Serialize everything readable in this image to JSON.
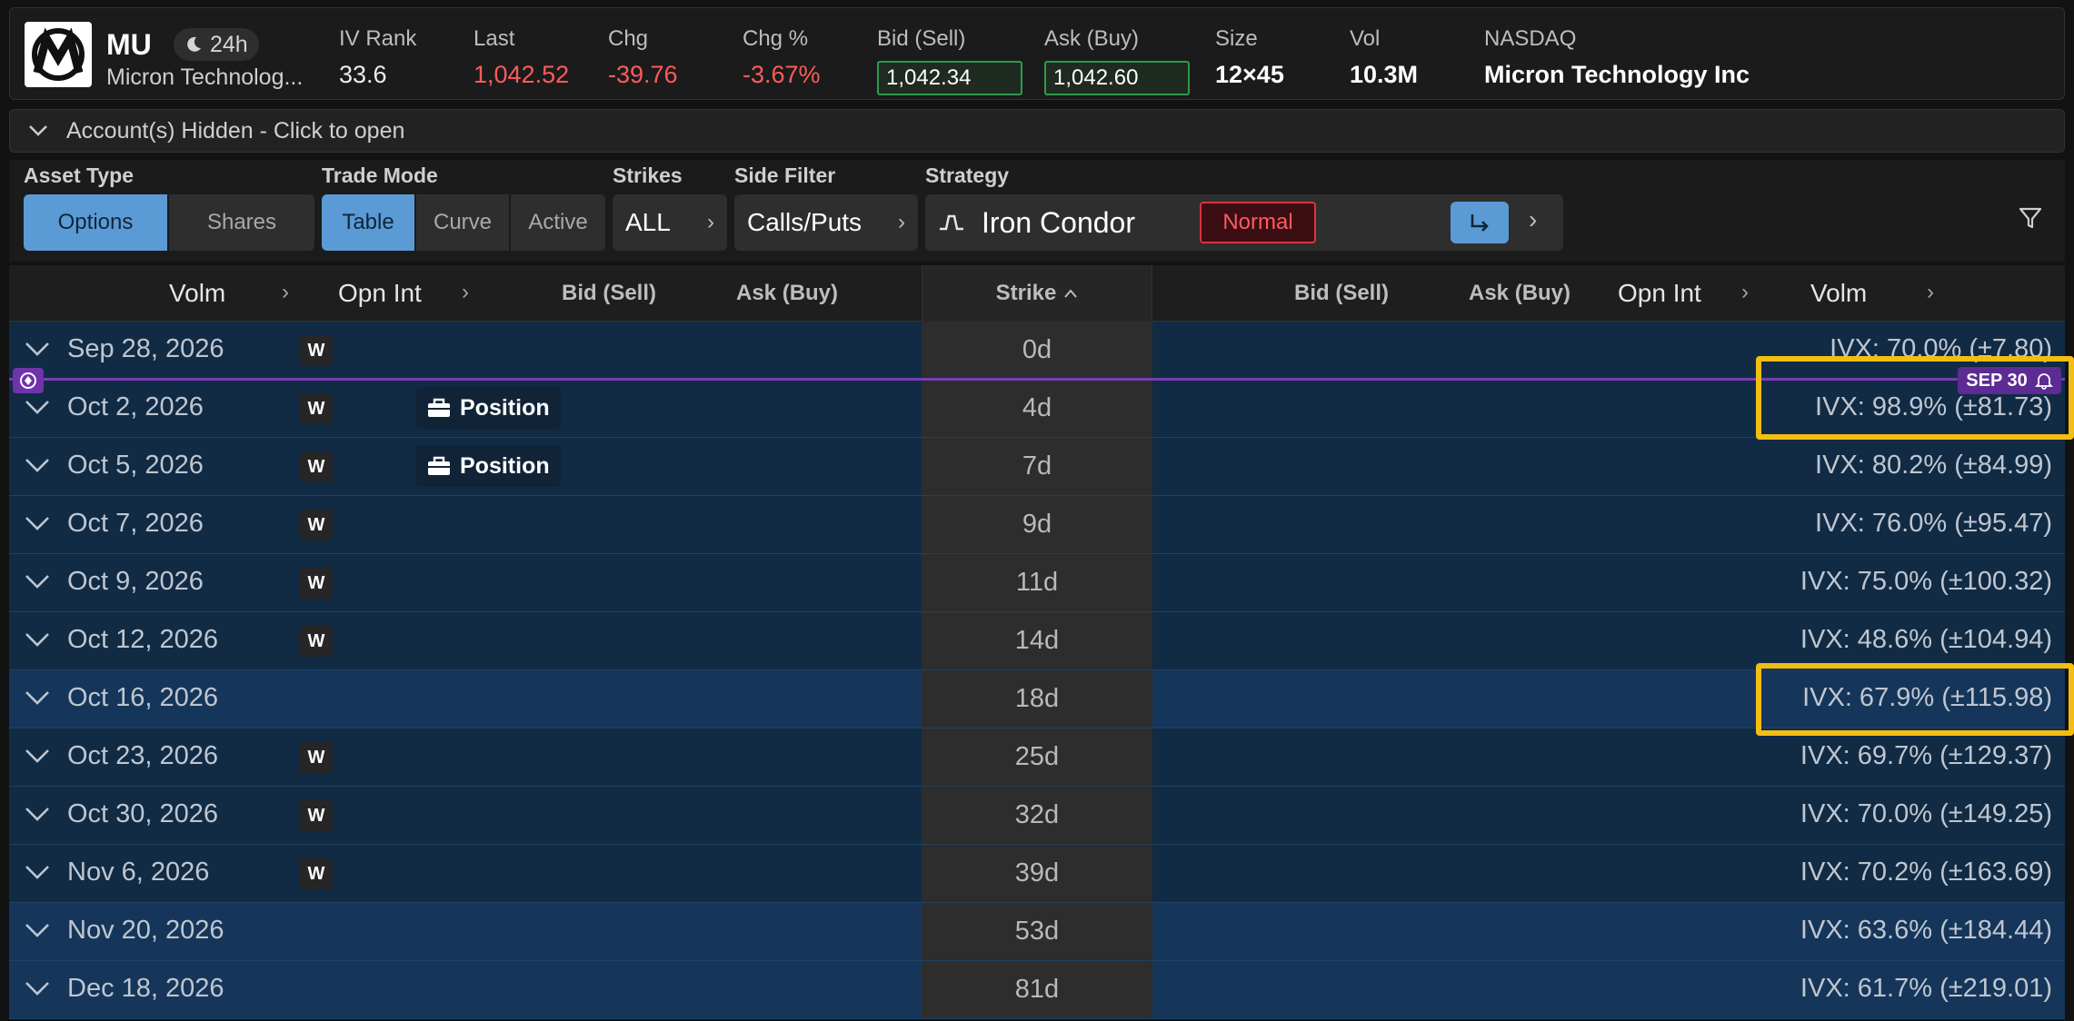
{
  "header": {
    "symbol": "MU",
    "session": "24h",
    "company_short": "Micron Technolog...",
    "ivrank": {
      "label": "IV Rank",
      "value": "33.6"
    },
    "last": {
      "label": "Last",
      "value": "1,042.52"
    },
    "chg": {
      "label": "Chg",
      "value": "-39.76"
    },
    "chgpct": {
      "label": "Chg %",
      "value": "-3.67%"
    },
    "bid": {
      "label": "Bid (Sell)",
      "value": "1,042.34"
    },
    "ask": {
      "label": "Ask (Buy)",
      "value": "1,042.60"
    },
    "size": {
      "label": "Size",
      "value": "12×45"
    },
    "vol": {
      "label": "Vol",
      "value": "10.3M"
    },
    "exchange": {
      "label": "NASDAQ",
      "value": "Micron Technology Inc"
    }
  },
  "accounts": {
    "label": "Account(s) Hidden - Click to open"
  },
  "toolbar": {
    "asset_type": {
      "label": "Asset Type",
      "options": [
        "Options",
        "Shares"
      ],
      "selected": "Options"
    },
    "trade_mode": {
      "label": "Trade Mode",
      "options": [
        "Table",
        "Curve",
        "Active"
      ],
      "selected": "Table"
    },
    "strikes": {
      "label": "Strikes",
      "value": "ALL"
    },
    "side_filter": {
      "label": "Side Filter",
      "value": "Calls/Puts"
    },
    "strategy": {
      "label": "Strategy",
      "value": "Iron Condor",
      "badge": "Normal"
    }
  },
  "columns": {
    "left": [
      "Volm",
      "Opn Int",
      "Bid (Sell)",
      "Ask (Buy)"
    ],
    "strike": "Strike",
    "right": [
      "Bid (Sell)",
      "Ask (Buy)",
      "Opn Int",
      "Volm"
    ]
  },
  "now_marker": {
    "label": "SEP 30"
  },
  "expirations": [
    {
      "date": "Sep 28, 2026",
      "weekly": "W",
      "position": "",
      "dte": "0d",
      "ivx": "IVX: 70.0% (±7.80)"
    },
    {
      "date": "Oct 2, 2026",
      "weekly": "W",
      "position": "Position",
      "dte": "4d",
      "ivx": "IVX: 98.9% (±81.73)"
    },
    {
      "date": "Oct 5, 2026",
      "weekly": "W",
      "position": "Position",
      "dte": "7d",
      "ivx": "IVX: 80.2% (±84.99)"
    },
    {
      "date": "Oct 7, 2026",
      "weekly": "W",
      "position": "",
      "dte": "9d",
      "ivx": "IVX: 76.0% (±95.47)"
    },
    {
      "date": "Oct 9, 2026",
      "weekly": "W",
      "position": "",
      "dte": "11d",
      "ivx": "IVX: 75.0% (±100.32)"
    },
    {
      "date": "Oct 12, 2026",
      "weekly": "W",
      "position": "",
      "dte": "14d",
      "ivx": "IVX: 48.6% (±104.94)"
    },
    {
      "date": "Oct 16, 2026",
      "weekly": "",
      "position": "",
      "dte": "18d",
      "ivx": "IVX: 67.9% (±115.98)"
    },
    {
      "date": "Oct 23, 2026",
      "weekly": "W",
      "position": "",
      "dte": "25d",
      "ivx": "IVX: 69.7% (±129.37)"
    },
    {
      "date": "Oct 30, 2026",
      "weekly": "W",
      "position": "",
      "dte": "32d",
      "ivx": "IVX: 70.0% (±149.25)"
    },
    {
      "date": "Nov 6, 2026",
      "weekly": "W",
      "position": "",
      "dte": "39d",
      "ivx": "IVX: 70.2% (±163.69)"
    },
    {
      "date": "Nov 20, 2026",
      "weekly": "",
      "position": "",
      "dte": "53d",
      "ivx": "IVX: 63.6% (±184.44)"
    },
    {
      "date": "Dec 18, 2026",
      "weekly": "",
      "position": "",
      "dte": "81d",
      "ivx": "IVX: 61.7% (±219.01)"
    }
  ],
  "colors": {
    "accent": "#5a9bd5",
    "negative": "#ff5b5b",
    "highlight": "#f3bd12",
    "row": "#112b45",
    "row_alt": "#15365a",
    "now_line": "#7b3bb5"
  }
}
